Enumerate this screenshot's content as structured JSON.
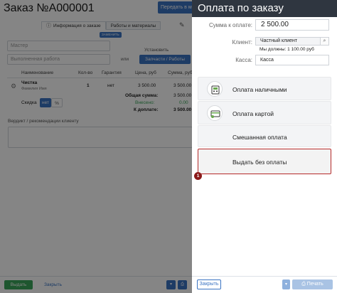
{
  "order": {
    "title": "Заказ №А000001",
    "transfer_button": "Передать в ма",
    "tabs": [
      {
        "label": "Информация о заказе",
        "icon": "info-icon"
      },
      {
        "label": "Работы и материалы",
        "icon": ""
      }
    ],
    "tab_tool_icon": "wrench-icon",
    "add_part_pill": "ЗАМЕНИТЬ",
    "master_placeholder": "Мастер",
    "work_placeholder": "Выполненная работа",
    "or_label": "или",
    "install_label": "Установить",
    "parts_button": "Запчасти / Работы",
    "table": {
      "headers": [
        "Наименование",
        "Кол-во",
        "Гарантия",
        "Цена, руб",
        "Сумма, руб"
      ],
      "rows": [
        {
          "name": "Чистка",
          "sub": "Фамилия Имя",
          "qty": "1",
          "warranty": "нет",
          "price": "3 500.00",
          "sum": "3 500.00"
        }
      ]
    },
    "discount_label": "Скидка",
    "discount_toggle": [
      "нет",
      "%"
    ],
    "totals": [
      {
        "label": "Общая сумма:",
        "value": "3 500.00"
      },
      {
        "label": "Внесено:",
        "value": "0.00"
      },
      {
        "label": "К доплате:",
        "value": "3 500.00"
      }
    ],
    "verdict_placeholder": "Вердикт / рекомендации клиенту",
    "issue_button": "Выдать",
    "close_link": "Закрыть"
  },
  "payment": {
    "title": "Оплата по заказу",
    "amount_label": "Сумма к оплате:",
    "amount_value": "2 500.00",
    "client_label": "Клиент:",
    "client_value": "Частный клиент",
    "client_search_icon": "search-icon",
    "client_debt": "Мы должны: 1 100.00 руб",
    "kassa_label": "Касса:",
    "kassa_value": "Касса",
    "options": [
      {
        "label": "Оплата наличными",
        "icon": "cash-icon"
      },
      {
        "label": "Оплата картой",
        "icon": "card-icon"
      },
      {
        "label": "Смешанная оплата",
        "icon": ""
      },
      {
        "label": "Выдать без оплаты",
        "icon": ""
      }
    ],
    "selected_badge": "1",
    "close_button": "Закрыть",
    "print_dropdown_icon": "chevron-down-icon",
    "print_button": "⎙ Печать"
  },
  "colors": {
    "header_dark": "#2f3640",
    "accent_blue": "#3a73c2",
    "highlight_red": "#b52a2a",
    "badge_red": "#8b1a1a",
    "paid_green": "#3ba55a"
  }
}
